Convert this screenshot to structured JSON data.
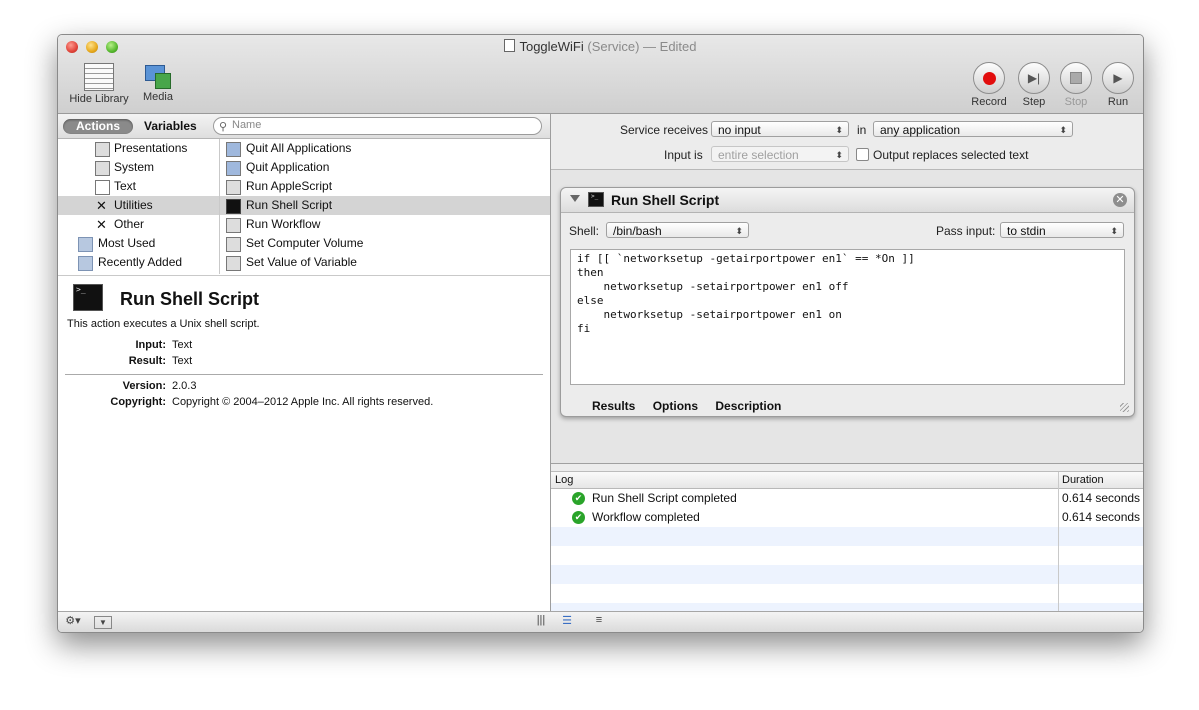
{
  "window": {
    "title": "ToggleWiFi",
    "title_kind": "(Service)",
    "title_state": "— Edited"
  },
  "toolbar": {
    "hide_library": "Hide Library",
    "media": "Media",
    "record": "Record",
    "step": "Step",
    "stop": "Stop",
    "run": "Run"
  },
  "library": {
    "tab_actions": "Actions",
    "tab_variables": "Variables",
    "search_placeholder": "Name",
    "categories": [
      {
        "label": "Presentations",
        "icon": "presentation-icon"
      },
      {
        "label": "System",
        "icon": "system-icon"
      },
      {
        "label": "Text",
        "icon": "text-icon"
      },
      {
        "label": "Utilities",
        "icon": "utilities-icon",
        "selected": true
      },
      {
        "label": "Other",
        "icon": "other-icon"
      },
      {
        "label": "Most Used",
        "icon": "folder-icon"
      },
      {
        "label": "Recently Added",
        "icon": "folder-icon"
      }
    ],
    "actions": [
      {
        "label": "Quit All Applications",
        "icon": "quit-icon"
      },
      {
        "label": "Quit Application",
        "icon": "quit-icon"
      },
      {
        "label": "Run AppleScript",
        "icon": "script-icon"
      },
      {
        "label": "Run Shell Script",
        "icon": "terminal-icon",
        "selected": true
      },
      {
        "label": "Run Workflow",
        "icon": "script-icon"
      },
      {
        "label": "Set Computer Volume",
        "icon": "volume-icon"
      },
      {
        "label": "Set Value of Variable",
        "icon": "script-icon"
      }
    ]
  },
  "description": {
    "title": "Run Shell Script",
    "text": "This action executes a Unix shell script.",
    "input_label": "Input:",
    "input_value": "Text",
    "result_label": "Result:",
    "result_value": "Text",
    "version_label": "Version:",
    "version_value": "2.0.3",
    "copyright_label": "Copyright:",
    "copyright_value": "Copyright © 2004–2012 Apple Inc.  All rights reserved."
  },
  "service": {
    "receives_label": "Service receives",
    "receives_value": "no input",
    "in_label": "in",
    "in_value": "any application",
    "input_is_label": "Input is",
    "input_is_value": "entire selection",
    "output_replaces_label": "Output replaces selected text"
  },
  "action_panel": {
    "title": "Run Shell Script",
    "shell_label": "Shell:",
    "shell_value": "/bin/bash",
    "pass_input_label": "Pass input:",
    "pass_input_value": "to stdin",
    "script": "if [[ `networksetup -getairportpower en1` == *On ]]\nthen\n    networksetup -setairportpower en1 off\nelse\n    networksetup -setairportpower en1 on\nfi ",
    "tab_results": "Results",
    "tab_options": "Options",
    "tab_description": "Description"
  },
  "log": {
    "col_log": "Log",
    "col_duration": "Duration",
    "rows": [
      {
        "text": "Run Shell Script completed",
        "duration": "0.614 seconds"
      },
      {
        "text": "Workflow completed",
        "duration": "0.614 seconds"
      }
    ]
  },
  "colors": {
    "record_red": "#e20d0d",
    "success_green": "#2aa42a",
    "selection_grey": "#d4d4d4"
  }
}
